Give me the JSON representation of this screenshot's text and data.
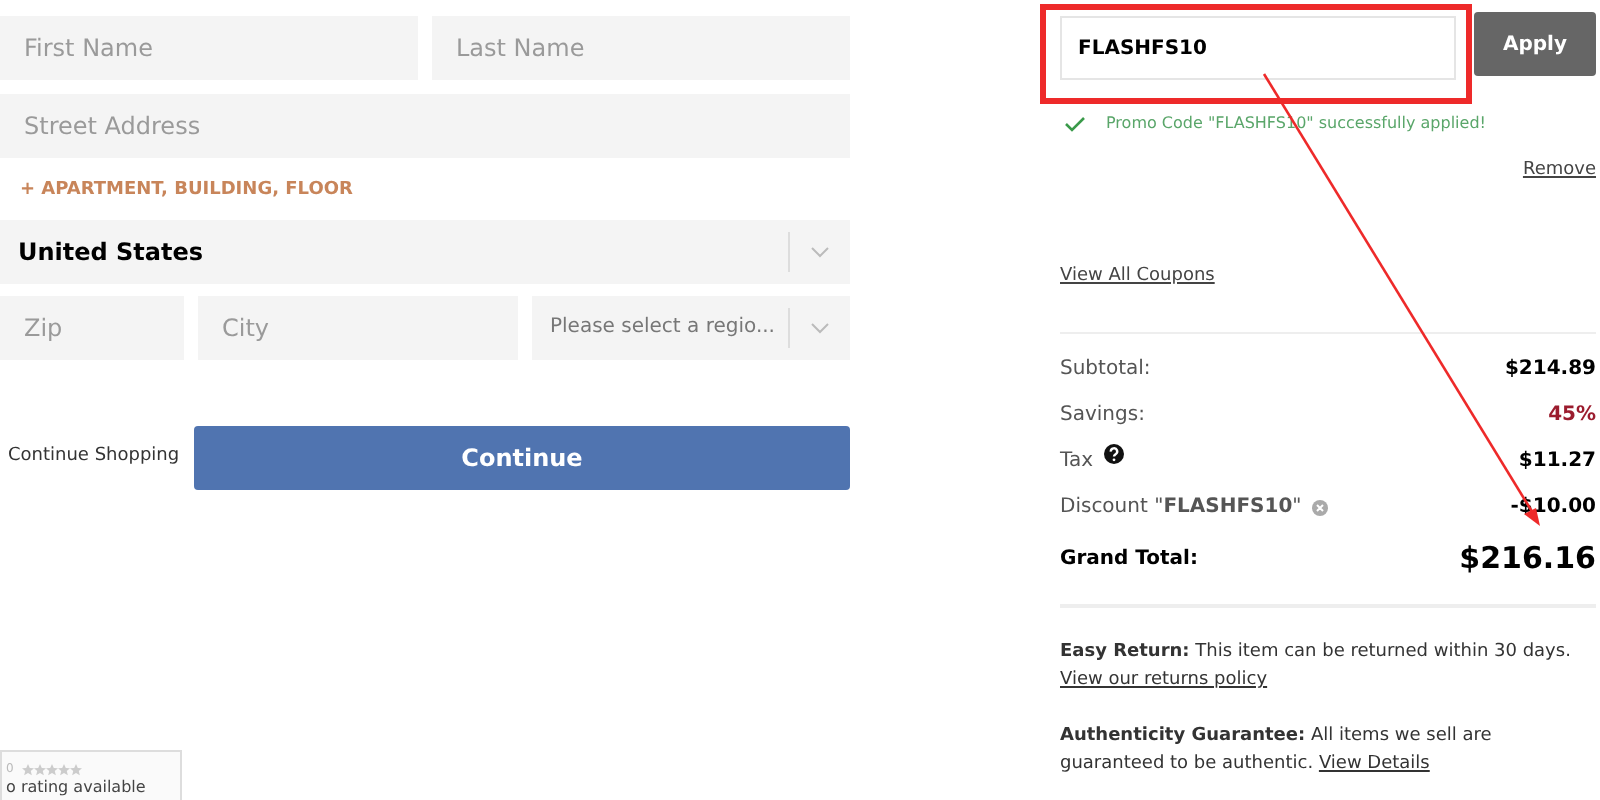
{
  "address_form": {
    "first_name": {
      "placeholder": "First Name"
    },
    "last_name": {
      "placeholder": "Last Name"
    },
    "street": {
      "placeholder": "Street Address"
    },
    "add_line_link": "+ APARTMENT, BUILDING, FLOOR",
    "country": {
      "value": "United States"
    },
    "zip": {
      "placeholder": "Zip"
    },
    "city": {
      "placeholder": "City"
    },
    "region": {
      "placeholder": "Please select a regio..."
    },
    "back_link": "Continue Shopping",
    "continue_button": "Continue"
  },
  "rating_widget": {
    "count": "0",
    "stars": 0,
    "text": "o rating available"
  },
  "promo": {
    "code": "FLASHFS10",
    "apply_button": "Apply",
    "success": "Promo Code \"FLASHFS10\" successfully applied!",
    "remove_link": "Remove",
    "coupons_link": "View All Coupons"
  },
  "summary": {
    "rows": [
      {
        "label": "Subtotal:",
        "value": "$214.89",
        "kind": "plain"
      },
      {
        "label": "Savings:",
        "value": "45%",
        "kind": "savings"
      },
      {
        "label": "Tax",
        "value": "$11.27",
        "kind": "help"
      },
      {
        "label": "Discount \"**FLASHFS10**\"",
        "value": "-$10.00",
        "kind": "removable"
      }
    ],
    "total_label": "Grand Total:",
    "total_value": "$216.16"
  },
  "notes": [
    {
      "text": "**Easy Return:** This item can be returned within 30 days.",
      "link": "View our returns policy"
    },
    {
      "text": "**Authenticity Guarantee:** All items we sell are guaranteed to be authentic.",
      "link": "View Details"
    }
  ]
}
